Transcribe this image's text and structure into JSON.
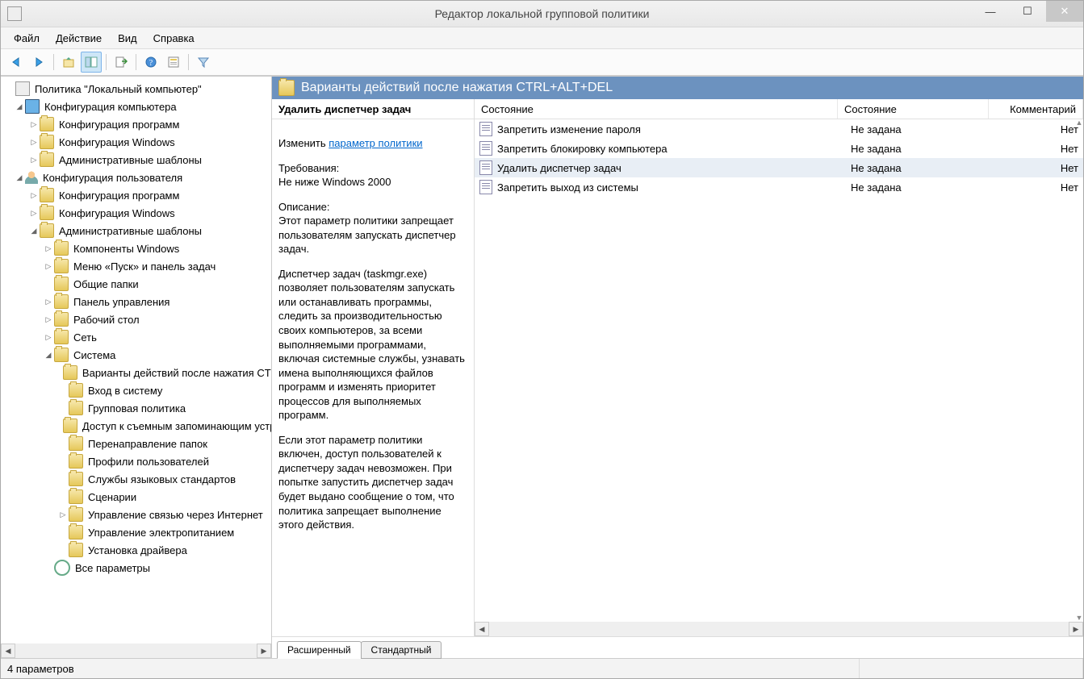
{
  "title": "Редактор локальной групповой политики",
  "menus": {
    "file": "Файл",
    "action": "Действие",
    "view": "Вид",
    "help": "Справка"
  },
  "tree": {
    "root": "Политика \"Локальный компьютер\"",
    "comp": "Конфигурация компьютера",
    "comp_prog": "Конфигурация программ",
    "comp_win": "Конфигурация Windows",
    "comp_admin": "Административные шаблоны",
    "user": "Конфигурация пользователя",
    "user_prog": "Конфигурация программ",
    "user_win": "Конфигурация Windows",
    "user_admin": "Административные шаблоны",
    "adm_wincomp": "Компоненты Windows",
    "adm_start": "Меню «Пуск» и панель задач",
    "adm_shared": "Общие папки",
    "adm_cp": "Панель управления",
    "adm_desk": "Рабочий стол",
    "adm_net": "Сеть",
    "adm_sys": "Система",
    "sys_cad": "Варианты действий после нажатия CTRL+ALT+DEL",
    "sys_logon": "Вход в систему",
    "sys_gp": "Групповая политика",
    "sys_removable": "Доступ к съемным запоминающим устройствам",
    "sys_folder": "Перенаправление папок",
    "sys_prof": "Профили пользователей",
    "sys_lang": "Службы языковых стандартов",
    "sys_scripts": "Сценарии",
    "sys_conn": "Управление связью через Интернет",
    "sys_power": "Управление электропитанием",
    "sys_driver": "Установка драйвера",
    "allsettings": "Все параметры"
  },
  "paneTitle": "Варианты действий после нажатия CTRL+ALT+DEL",
  "desc": {
    "heading": "Удалить диспетчер задач",
    "change": "Изменить",
    "link": "параметр политики",
    "req_lbl": "Требования:",
    "req_val": "Не ниже Windows 2000",
    "sec_lbl": "Описание:",
    "p1": "Этот параметр политики запрещает пользователям запускать диспетчер задач.",
    "p2": "Диспетчер задач (taskmgr.exe) позволяет пользователям запускать или останавливать программы, следить за производительностью своих компьютеров, за всеми выполняемыми программами, включая системные службы, узнавать имена выполняющихся файлов программ и изменять приоритет процессов для выполняемых программ.",
    "p3": "Если этот параметр политики включен, доступ пользователей к диспетчеру задач невозможен. При попытке запустить диспетчер задач будет выдано сообщение о том, что политика запрещает выполнение этого действия."
  },
  "listcols": {
    "c1": "Состояние",
    "c2": "Состояние",
    "c3": "Комментарий"
  },
  "rows": [
    {
      "name": "Запретить изменение пароля",
      "state": "Не задана",
      "comment": "Нет",
      "sel": false
    },
    {
      "name": "Запретить блокировку компьютера",
      "state": "Не задана",
      "comment": "Нет",
      "sel": false
    },
    {
      "name": "Удалить диспетчер задач",
      "state": "Не задана",
      "comment": "Нет",
      "sel": true
    },
    {
      "name": "Запретить выход из системы",
      "state": "Не задана",
      "comment": "Нет",
      "sel": false
    }
  ],
  "tabs": {
    "ext": "Расширенный",
    "std": "Стандартный"
  },
  "status": "4 параметров"
}
